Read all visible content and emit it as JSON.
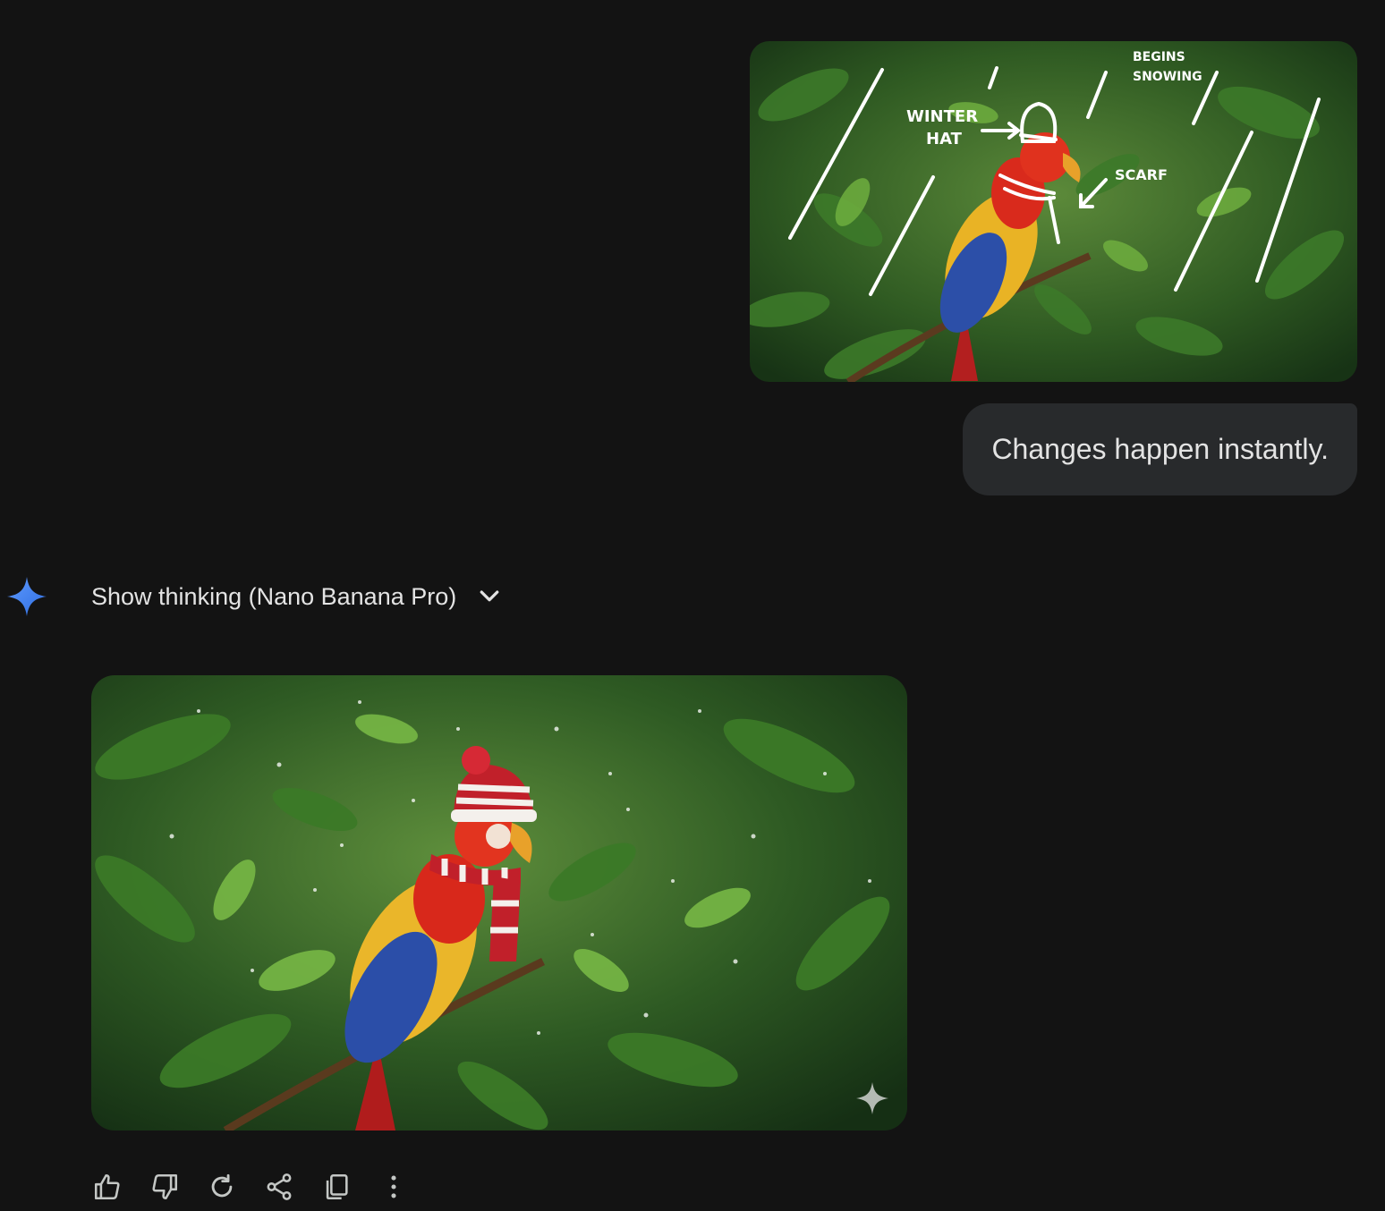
{
  "user_turn": {
    "image": {
      "alt": "Parrot in leaves with sketched annotations",
      "annotations": [
        "WINTER\nHAT",
        "BEGINS\nSNOWING",
        "SCARF"
      ]
    },
    "message": "Changes happen instantly."
  },
  "model_turn": {
    "icon": "gemini-sparkle-icon",
    "thinking_label": "Show thinking (Nano Banana Pro)",
    "image": {
      "alt": "Parrot wearing knit winter hat and scarf in snowy jungle"
    },
    "actions": [
      {
        "name": "thumbs-up-icon",
        "label": "Good response"
      },
      {
        "name": "thumbs-down-icon",
        "label": "Bad response"
      },
      {
        "name": "redo-icon",
        "label": "Redo"
      },
      {
        "name": "share-icon",
        "label": "Share"
      },
      {
        "name": "copy-icon",
        "label": "Copy"
      },
      {
        "name": "more-options-icon",
        "label": "More options"
      }
    ]
  },
  "colors": {
    "background": "#131313",
    "bubble": "#282a2c",
    "text": "#e3e3e3",
    "gemini_blue": "#4285f4"
  }
}
